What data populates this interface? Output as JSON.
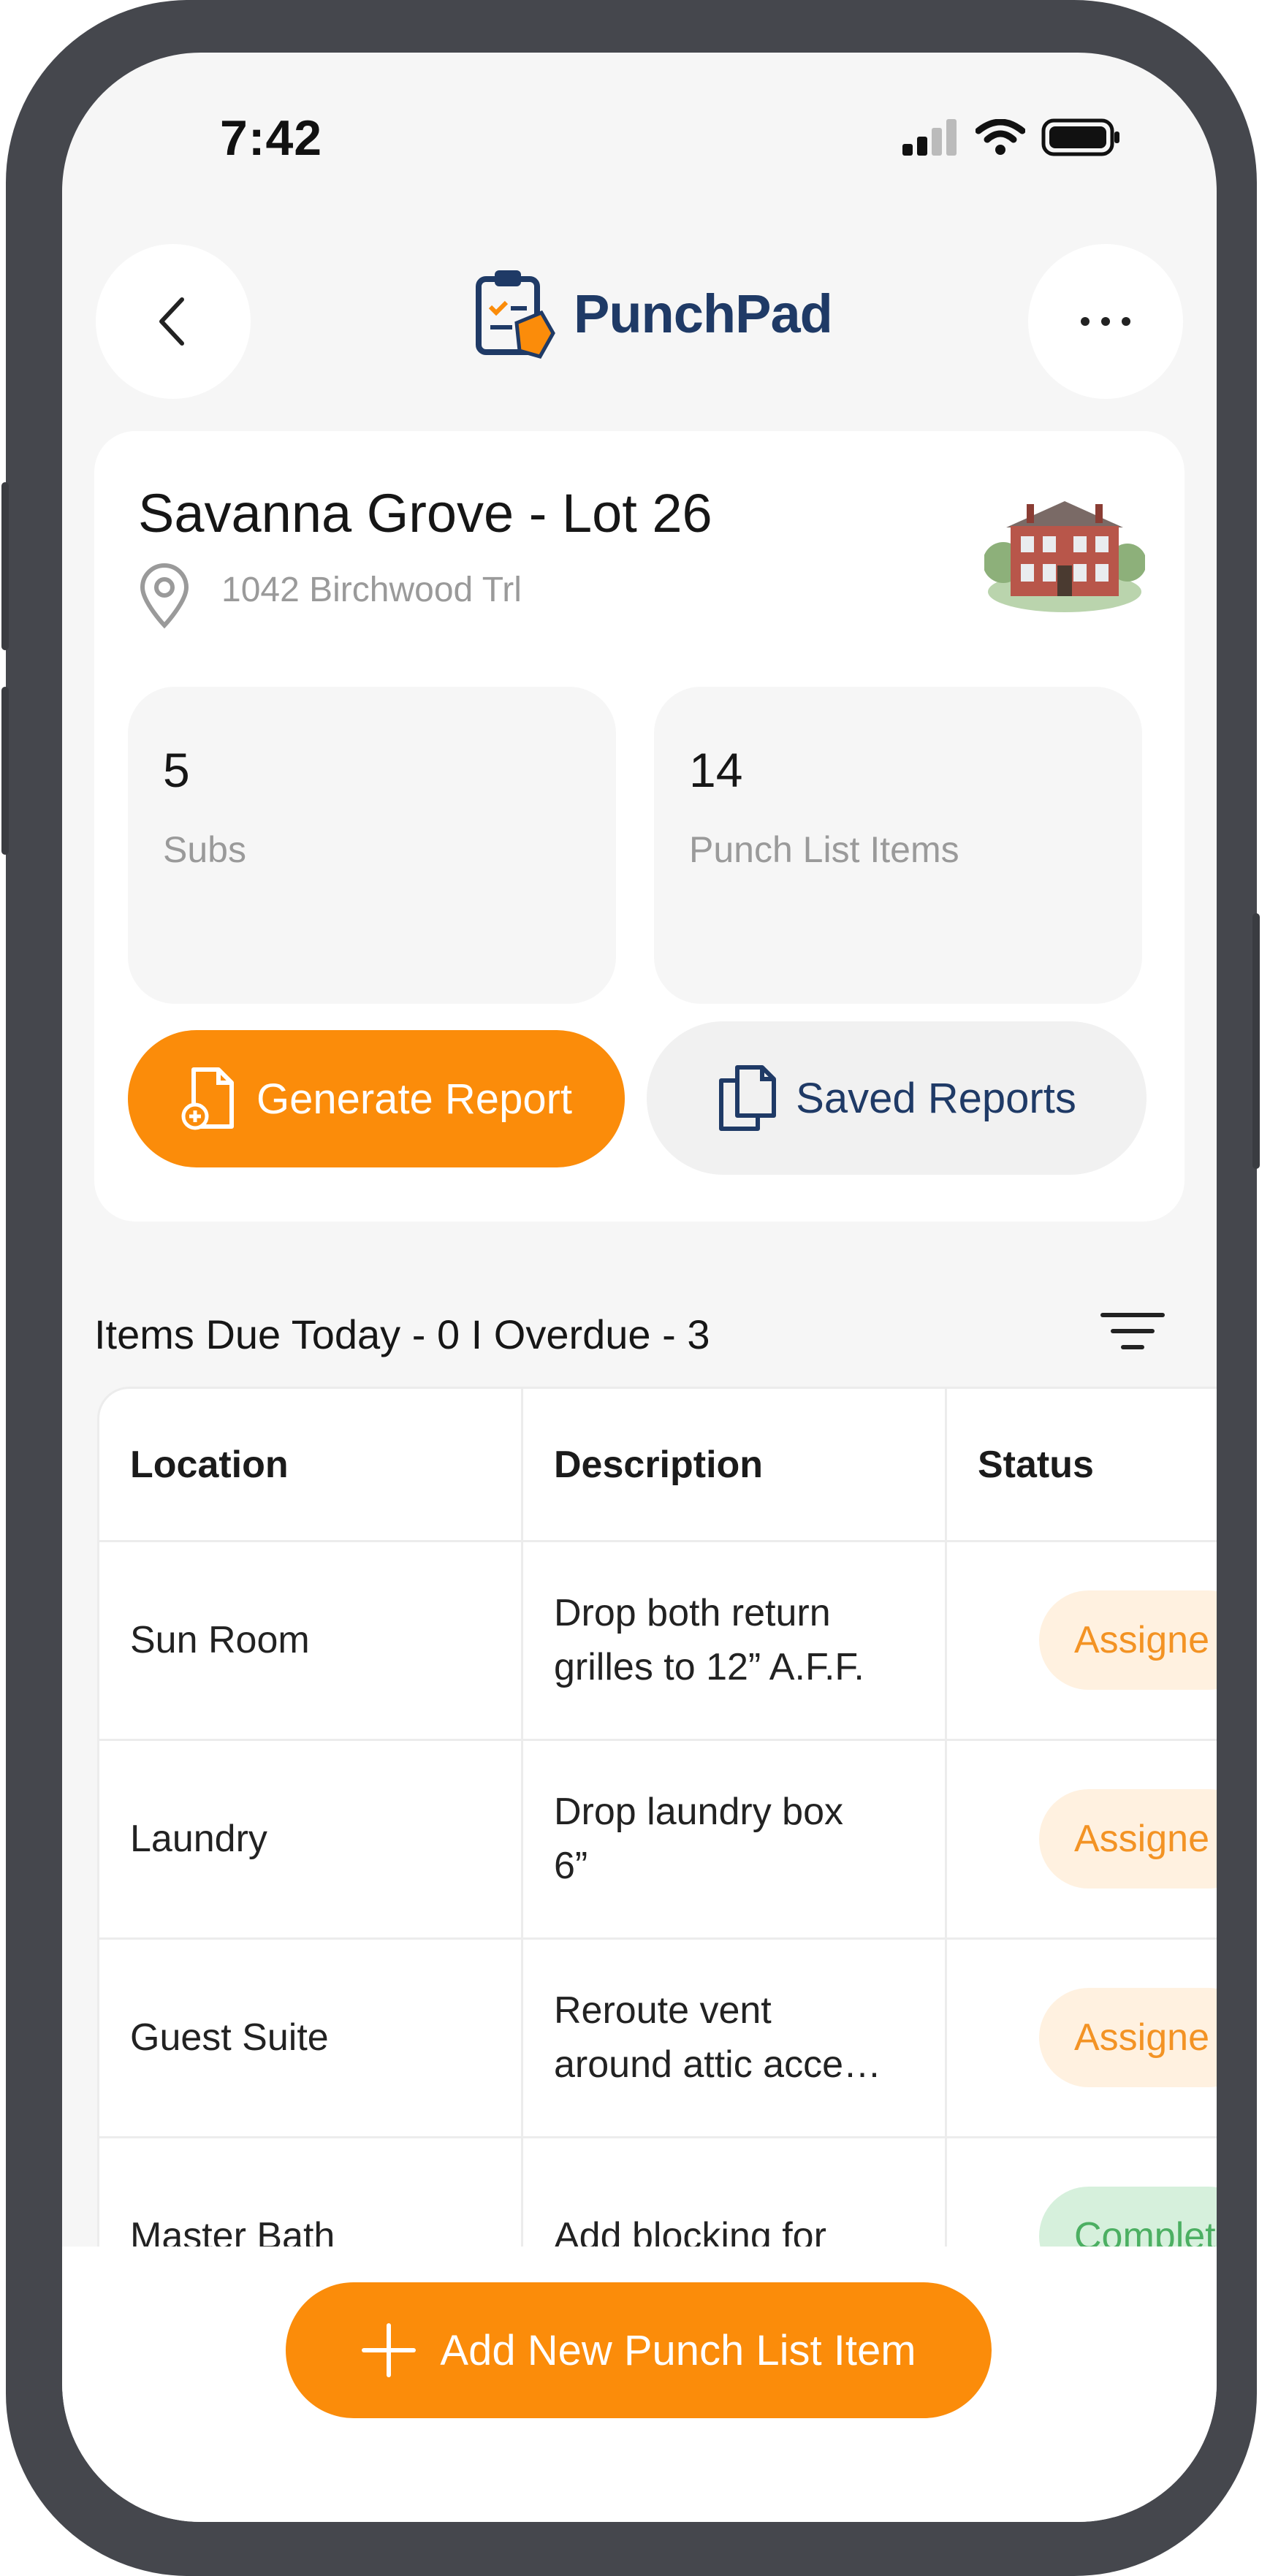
{
  "status_bar": {
    "time": "7:42"
  },
  "header": {
    "app_name": "PunchPad"
  },
  "project": {
    "title": "Savanna Grove - Lot 26",
    "address": "1042 Birchwood Trl",
    "stats": [
      {
        "value": "5",
        "label": "Subs"
      },
      {
        "value": "14",
        "label": "Punch List Items"
      }
    ],
    "actions": {
      "generate": "Generate Report",
      "saved": "Saved Reports"
    }
  },
  "items_summary": "Items Due Today - 0 I Overdue - 3",
  "table": {
    "headers": [
      "Location",
      "Description",
      "Status"
    ],
    "rows": [
      {
        "location": "Sun Room",
        "desc_1": "Drop both return",
        "desc_2": "grilles to 12” A.F.F.",
        "status": "Assigne"
      },
      {
        "location": "Laundry",
        "desc_1": "Drop laundry box",
        "desc_2": "6”",
        "status": "Assigne"
      },
      {
        "location": "Guest Suite",
        "desc_1": "Reroute vent",
        "desc_2": "around attic acce…",
        "status": "Assigne"
      },
      {
        "location": "Master Bath",
        "desc_1": "Add blocking for",
        "desc_2": "",
        "status": "Complete"
      }
    ]
  },
  "add_button": "Add New Punch List Item",
  "colors": {
    "accent": "#fb8c0a",
    "brand": "#1f3a66",
    "assigned_text": "#f39324",
    "completed_text": "#4caf62"
  }
}
